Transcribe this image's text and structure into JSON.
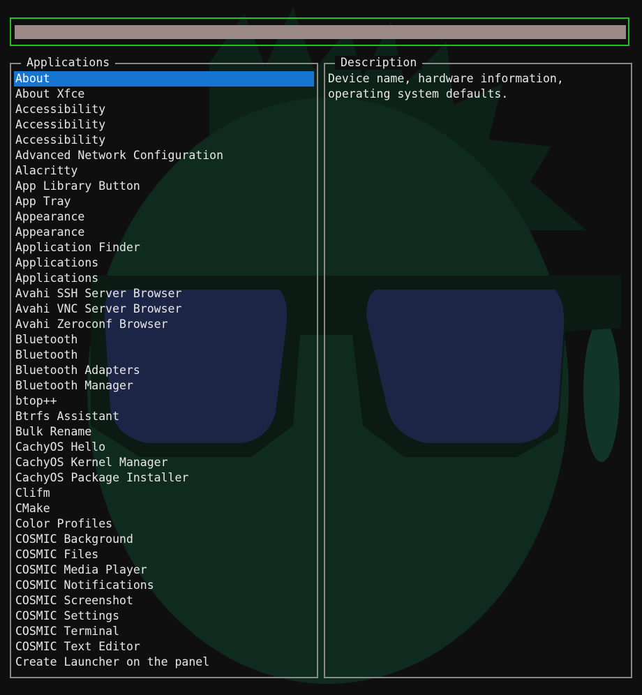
{
  "search": {
    "value": "",
    "placeholder": ""
  },
  "applications": {
    "title": "Applications",
    "selected_index": 0,
    "items": [
      "About",
      "About Xfce",
      "Accessibility",
      "Accessibility",
      "Accessibility",
      "Advanced Network Configuration",
      "Alacritty",
      "App Library Button",
      "App Tray",
      "Appearance",
      "Appearance",
      "Application Finder",
      "Applications",
      "Applications",
      "Avahi SSH Server Browser",
      "Avahi VNC Server Browser",
      "Avahi Zeroconf Browser",
      "Bluetooth",
      "Bluetooth",
      "Bluetooth Adapters",
      "Bluetooth Manager",
      "btop++",
      "Btrfs Assistant",
      "Bulk Rename",
      "CachyOS Hello",
      "CachyOS Kernel Manager",
      "CachyOS Package Installer",
      "Clifm",
      "CMake",
      "Color Profiles",
      "COSMIC Background",
      "COSMIC Files",
      "COSMIC Media Player",
      "COSMIC Notifications",
      "COSMIC Screenshot",
      "COSMIC Settings",
      "COSMIC Terminal",
      "COSMIC Text Editor",
      "Create Launcher on the panel"
    ]
  },
  "description": {
    "title": "Description",
    "text": "Device name, hardware information,\noperating system defaults."
  },
  "colors": {
    "background": "#0f0f0f",
    "search_border": "#22c31f",
    "search_fill": "#9a8987",
    "panel_border": "#8a8a8a",
    "selection": "#1675d1",
    "text": "#e8e8e8",
    "wallpaper_face": "#0f2a1f",
    "wallpaper_lens": "#1c2546",
    "wallpaper_frame": "#0b1a13"
  }
}
